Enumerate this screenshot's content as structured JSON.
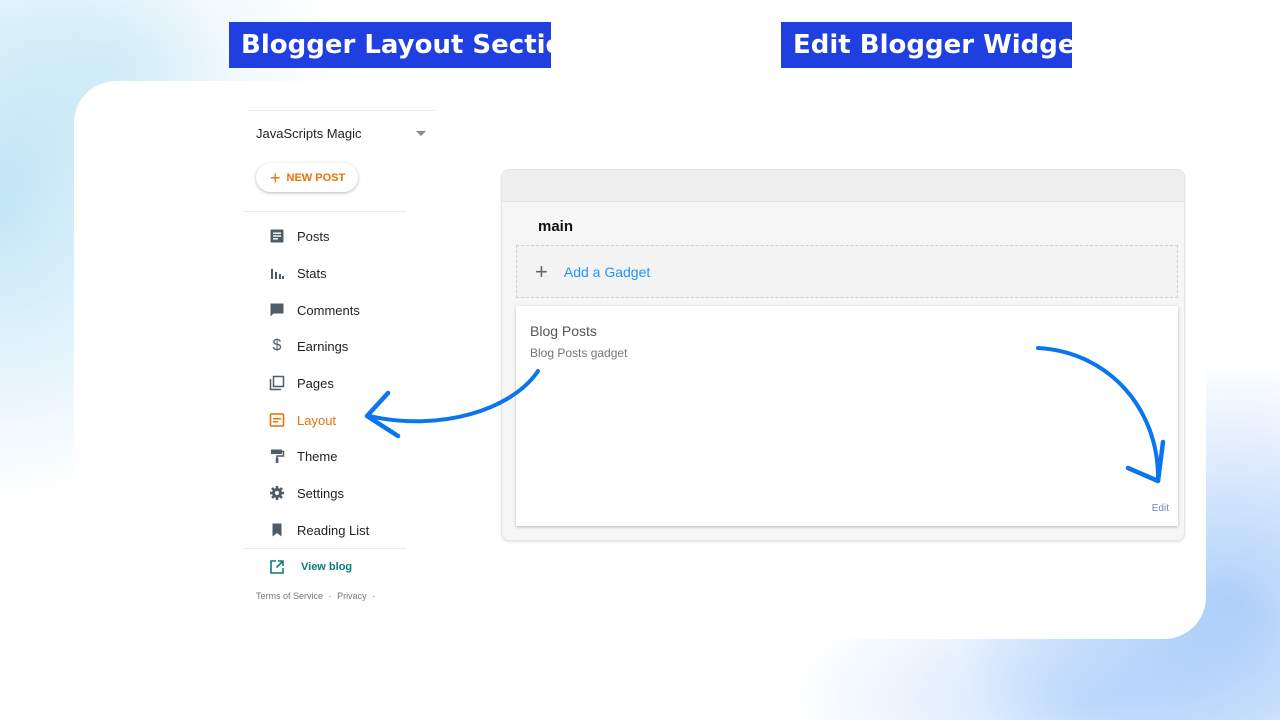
{
  "headings": {
    "left": "Blogger Layout Section",
    "right": "Edit Blogger Widgets"
  },
  "colors": {
    "heading_bg": "#1f3fe0",
    "accent_orange": "#e8710a",
    "link_blue": "#2196f3",
    "arrow_blue": "#0a75f0",
    "view_blog_teal": "#0b7b80"
  },
  "sidebar": {
    "blog_name": "JavaScripts Magic",
    "new_post_label": "NEW POST",
    "items": [
      {
        "label": "Posts",
        "icon": "posts-icon"
      },
      {
        "label": "Stats",
        "icon": "stats-icon"
      },
      {
        "label": "Comments",
        "icon": "comments-icon"
      },
      {
        "label": "Earnings",
        "icon": "dollar-icon"
      },
      {
        "label": "Pages",
        "icon": "pages-icon"
      },
      {
        "label": "Layout",
        "icon": "layout-icon",
        "active": true
      },
      {
        "label": "Theme",
        "icon": "paint-roller-icon"
      },
      {
        "label": "Settings",
        "icon": "gear-icon"
      },
      {
        "label": "Reading List",
        "icon": "bookmark-icon"
      }
    ],
    "view_blog_label": "View blog",
    "footer": {
      "terms": "Terms of Service",
      "separator": "·",
      "privacy": "Privacy",
      "trailing": "·"
    }
  },
  "layout_editor": {
    "section_title": "main",
    "add_gadget_label": "Add a Gadget",
    "gadget": {
      "title": "Blog Posts",
      "subtitle": "Blog Posts gadget",
      "edit_label": "Edit"
    }
  }
}
